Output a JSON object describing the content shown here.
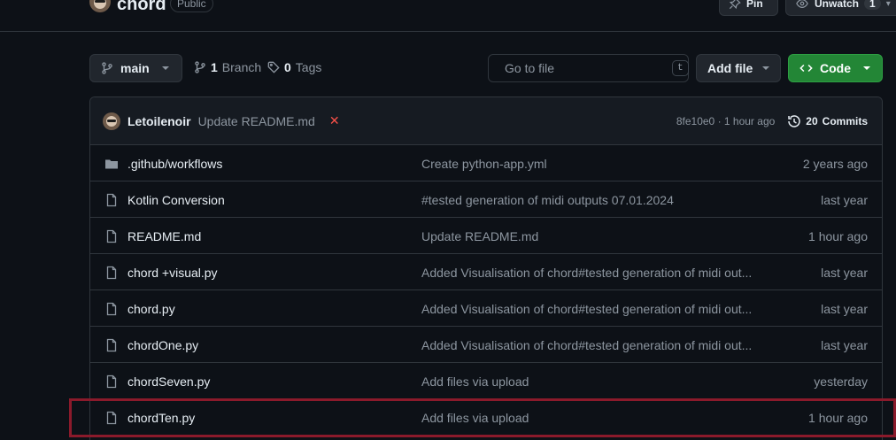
{
  "repo": {
    "name": "chord",
    "visibility": "Public",
    "pin_label": "Pin",
    "watch_label": "Unwatch",
    "watch_count": "1"
  },
  "toolbar": {
    "branch": "main",
    "branches_count": "1",
    "branches_label": "Branch",
    "tags_count": "0",
    "tags_label": "Tags",
    "search_placeholder": "Go to file",
    "search_shortcut": "t",
    "add_file_label": "Add file",
    "code_label": "Code"
  },
  "latest_commit": {
    "author": "Letoilenoir",
    "message": "Update README.md",
    "status_icon": "x-icon",
    "hash": "8fe10e0",
    "age": "1 hour ago",
    "hash_sep": " · ",
    "commits_count": "20",
    "commits_label": "Commits"
  },
  "files": [
    {
      "type": "folder",
      "name": ".github/workflows",
      "commit": "Create python-app.yml",
      "time": "2 years ago"
    },
    {
      "type": "file",
      "name": "Kotlin Conversion",
      "commit": "#tested generation of midi outputs 07.01.2024",
      "time": "last year"
    },
    {
      "type": "file",
      "name": "README.md",
      "commit": "Update README.md",
      "time": "1 hour ago"
    },
    {
      "type": "file",
      "name": "chord +visual.py",
      "commit": "Added Visualisation of chord#tested generation of midi out...",
      "time": "last year"
    },
    {
      "type": "file",
      "name": "chord.py",
      "commit": "Added Visualisation of chord#tested generation of midi out...",
      "time": "last year"
    },
    {
      "type": "file",
      "name": "chordOne.py",
      "commit": "Added Visualisation of chord#tested generation of midi out...",
      "time": "last year"
    },
    {
      "type": "file",
      "name": "chordSeven.py",
      "commit": "Add files via upload",
      "time": "yesterday"
    },
    {
      "type": "file",
      "name": "chordTen.py",
      "commit": "Add files via upload",
      "time": "1 hour ago"
    }
  ],
  "colors": {
    "background": "#0d1117",
    "accent_green": "#238636",
    "highlight_border": "#8b1a2b",
    "fail_red": "#f85149"
  }
}
